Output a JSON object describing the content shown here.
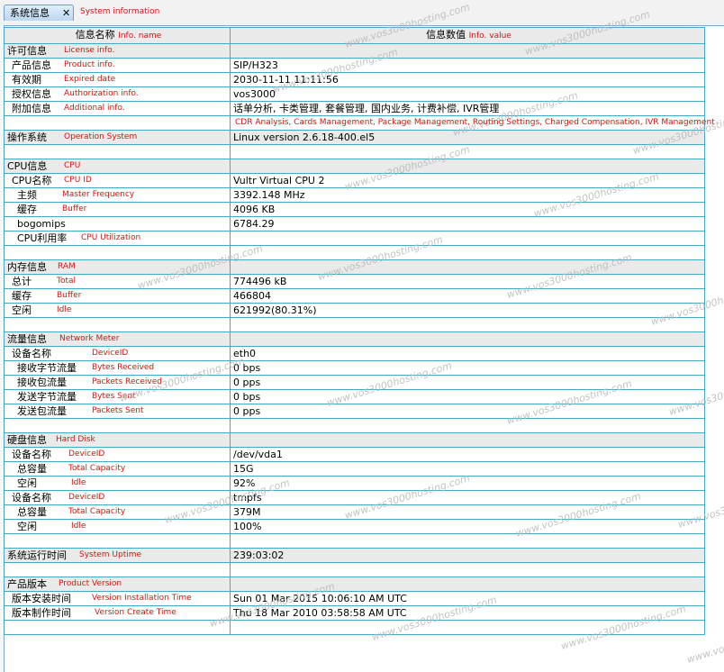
{
  "tab": {
    "label": "系统信息",
    "close": "✕",
    "annot": "System information"
  },
  "watermark": "www.vos3000hosting.com",
  "header": {
    "col_name": "信息名称",
    "col_name_annot": "Info. name",
    "col_value": "信息数值",
    "col_value_annot": "Info. value"
  },
  "rows": [
    {
      "label": "许可信息",
      "annot": "License info.",
      "value": "",
      "type": "sec",
      "indent": 0,
      "apos": 66
    },
    {
      "label": "产品信息",
      "annot": "Product info.",
      "value": "SIP/H323",
      "type": "row",
      "indent": 1,
      "apos": 66
    },
    {
      "label": "有效期",
      "annot": "Expired date",
      "value": "2030-11-11 11:11:56",
      "type": "row",
      "indent": 1,
      "apos": 66
    },
    {
      "label": "授权信息",
      "annot": "Authorization info.",
      "value": "vos3000",
      "type": "row",
      "indent": 1,
      "apos": 66
    },
    {
      "label": "附加信息",
      "annot": "Additional info.",
      "value": "话单分析, 卡类管理, 套餐管理, 国内业务, 计费补偿, IVR管理",
      "type": "row",
      "indent": 1,
      "apos": 66
    },
    {
      "label": "",
      "annot": "",
      "value": "",
      "value_annot": "CDR Analysis, Cards Management, Package Management, Routing Settings, Charged Compensation, IVR Management",
      "type": "blank",
      "indent": 0,
      "apos": 66
    },
    {
      "label": "操作系统",
      "annot": "Operation System",
      "value": "Linux version 2.6.18-400.el5",
      "type": "sec",
      "indent": 0,
      "apos": 66
    },
    {
      "label": "",
      "annot": "",
      "value": "",
      "type": "blank",
      "indent": 0,
      "apos": 66
    },
    {
      "label": "CPU信息",
      "annot": "CPU",
      "value": "",
      "type": "sec",
      "indent": 0,
      "apos": 66
    },
    {
      "label": "CPU名称",
      "annot": "CPU ID",
      "value": "Vultr Virtual CPU 2",
      "type": "row",
      "indent": 1,
      "apos": 66
    },
    {
      "label": "主频",
      "annot": "Master Frequency",
      "value": "3392.148 MHz",
      "type": "row",
      "indent": 2,
      "apos": 64
    },
    {
      "label": "缓存",
      "annot": "Buffer",
      "value": "4096 KB",
      "type": "row",
      "indent": 2,
      "apos": 64
    },
    {
      "label": "bogomips",
      "annot": "",
      "value": "6784.29",
      "type": "row",
      "indent": 2,
      "apos": 64
    },
    {
      "label": "CPU利用率",
      "annot": "CPU Utilization",
      "value": "",
      "type": "row",
      "indent": 2,
      "apos": 85
    },
    {
      "label": "",
      "annot": "",
      "value": "",
      "type": "blank",
      "indent": 0,
      "apos": 66
    },
    {
      "label": "内存信息",
      "annot": "RAM",
      "value": "",
      "type": "sec",
      "indent": 0,
      "apos": 59
    },
    {
      "label": "总计",
      "annot": "Total",
      "value": "774496 kB",
      "type": "row",
      "indent": 1,
      "apos": 58
    },
    {
      "label": "缓存",
      "annot": "Buffer",
      "value": "466804",
      "type": "row",
      "indent": 1,
      "apos": 58
    },
    {
      "label": "空闲",
      "annot": "Idle",
      "value": "621992(80.31%)",
      "type": "row",
      "indent": 1,
      "apos": 58
    },
    {
      "label": "",
      "annot": "",
      "value": "",
      "type": "blank",
      "indent": 0,
      "apos": 66
    },
    {
      "label": "流量信息",
      "annot": "Network Meter",
      "value": "",
      "type": "sec",
      "indent": 0,
      "apos": 61
    },
    {
      "label": "设备名称",
      "annot": "DeviceID",
      "value": "eth0",
      "type": "row",
      "indent": 1,
      "apos": 97
    },
    {
      "label": "接收字节流量",
      "annot": "Bytes Received",
      "value": "0 bps",
      "type": "row",
      "indent": 2,
      "apos": 97
    },
    {
      "label": "接收包流量",
      "annot": "Packets Received",
      "value": "0 pps",
      "type": "row",
      "indent": 2,
      "apos": 97
    },
    {
      "label": "发送字节流量",
      "annot": "Bytes Sent",
      "value": "0 bps",
      "type": "row",
      "indent": 2,
      "apos": 97
    },
    {
      "label": "发送包流量",
      "annot": "Packets Sent",
      "value": "0 pps",
      "type": "row",
      "indent": 2,
      "apos": 97
    },
    {
      "label": "",
      "annot": "",
      "value": "",
      "type": "blank",
      "indent": 0,
      "apos": 66
    },
    {
      "label": "硬盘信息",
      "annot": "Hard Disk",
      "value": "",
      "type": "sec",
      "indent": 0,
      "apos": 57
    },
    {
      "label": "设备名称",
      "annot": "DeviceID",
      "value": "/dev/vda1",
      "type": "row",
      "indent": 1,
      "apos": 71
    },
    {
      "label": "总容量",
      "annot": "Total Capacity",
      "value": "15G",
      "type": "row",
      "indent": 2,
      "apos": 71
    },
    {
      "label": "空闲",
      "annot": "Idle",
      "value": "92%",
      "type": "row",
      "indent": 2,
      "apos": 74
    },
    {
      "label": "设备名称",
      "annot": "DeviceID",
      "value": "tmpfs",
      "type": "row",
      "indent": 1,
      "apos": 71
    },
    {
      "label": "总容量",
      "annot": "Total Capacity",
      "value": "379M",
      "type": "row",
      "indent": 2,
      "apos": 71
    },
    {
      "label": "空闲",
      "annot": "Idle",
      "value": "100%",
      "type": "row",
      "indent": 2,
      "apos": 74
    },
    {
      "label": "",
      "annot": "",
      "value": "",
      "type": "blank",
      "indent": 0,
      "apos": 66
    },
    {
      "label": "系统运行时间",
      "annot": "System Uptime",
      "value": "239:03:02",
      "type": "sec",
      "indent": 0,
      "apos": 83
    },
    {
      "label": "",
      "annot": "",
      "value": "",
      "type": "blank",
      "indent": 0,
      "apos": 66
    },
    {
      "label": "产品版本",
      "annot": "Product Version",
      "value": "",
      "type": "sec",
      "indent": 0,
      "apos": 60
    },
    {
      "label": "版本安装时间",
      "annot": "Version Installation Time",
      "value": "Sun 01 Mar 2015 10:06:10 AM UTC",
      "type": "row",
      "indent": 1,
      "apos": 97
    },
    {
      "label": "版本制作时间",
      "annot": "Version Create Time",
      "value": "Thu 18 Mar 2010 03:58:58 AM UTC",
      "type": "row",
      "indent": 1,
      "apos": 100
    },
    {
      "label": "",
      "annot": "",
      "value": "",
      "type": "blank",
      "indent": 0,
      "apos": 66
    }
  ]
}
